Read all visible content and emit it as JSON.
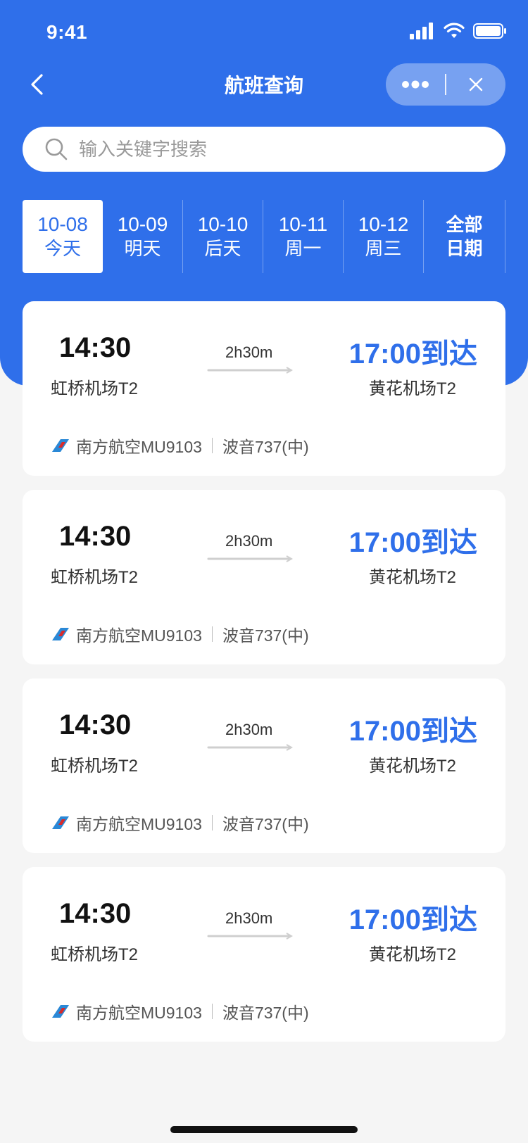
{
  "status_bar": {
    "time": "9:41"
  },
  "nav": {
    "title": "航班查询"
  },
  "search": {
    "placeholder": "输入关键字搜索",
    "value": ""
  },
  "date_tabs": [
    {
      "date": "10-08",
      "label": "今天",
      "active": true
    },
    {
      "date": "10-09",
      "label": "明天",
      "active": false
    },
    {
      "date": "10-10",
      "label": "后天",
      "active": false
    },
    {
      "date": "10-11",
      "label": "周一",
      "active": false
    },
    {
      "date": "10-12",
      "label": "周三",
      "active": false
    },
    {
      "date": "全部",
      "label": "日期",
      "active": false
    }
  ],
  "flights": [
    {
      "dep_time": "14:30",
      "dep_airport": "虹桥机场T2",
      "duration": "2h30m",
      "arr_time": "17:00到达",
      "arr_airport": "黄花机场T2",
      "airline": "南方航空MU9103",
      "aircraft": "波音737(中)"
    },
    {
      "dep_time": "14:30",
      "dep_airport": "虹桥机场T2",
      "duration": "2h30m",
      "arr_time": "17:00到达",
      "arr_airport": "黄花机场T2",
      "airline": "南方航空MU9103",
      "aircraft": "波音737(中)"
    },
    {
      "dep_time": "14:30",
      "dep_airport": "虹桥机场T2",
      "duration": "2h30m",
      "arr_time": "17:00到达",
      "arr_airport": "黄花机场T2",
      "airline": "南方航空MU9103",
      "aircraft": "波音737(中)"
    },
    {
      "dep_time": "14:30",
      "dep_airport": "虹桥机场T2",
      "duration": "2h30m",
      "arr_time": "17:00到达",
      "arr_airport": "黄花机场T2",
      "airline": "南方航空MU9103",
      "aircraft": "波音737(中)"
    }
  ],
  "colors": {
    "primary": "#2f6fea",
    "background": "#f5f5f5",
    "card": "#ffffff"
  },
  "icons": {
    "back": "chevron-left-icon",
    "more": "more-dots-icon",
    "close": "close-icon",
    "search": "search-icon",
    "airline": "china-southern-logo-icon"
  }
}
